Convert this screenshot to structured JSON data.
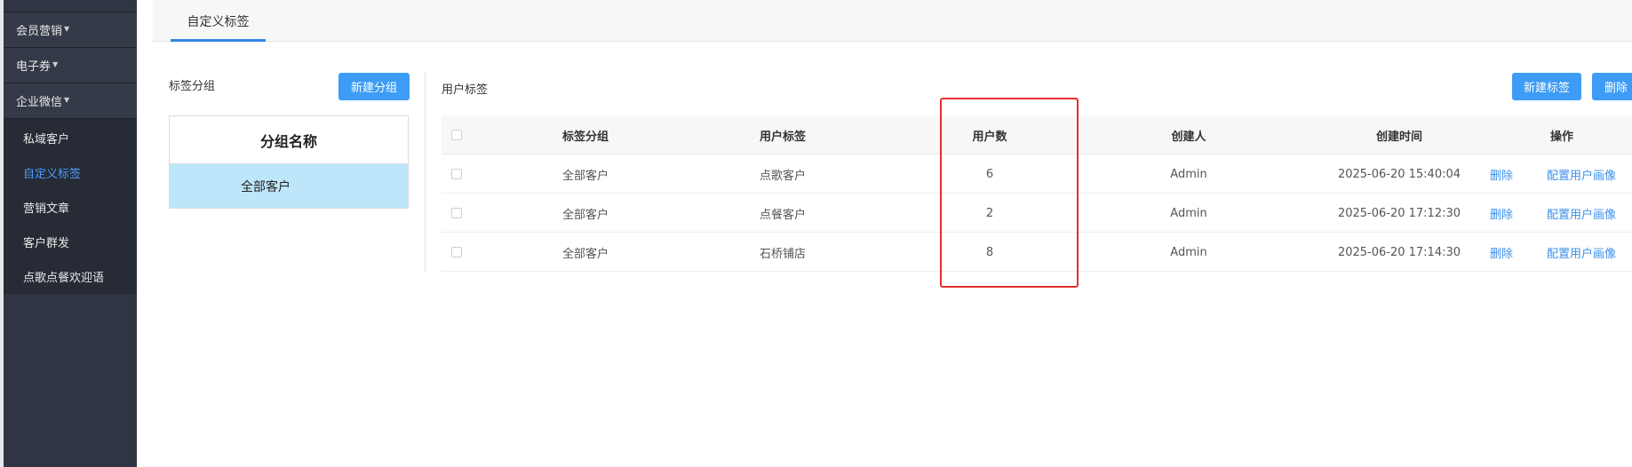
{
  "sidebar": {
    "groups": [
      {
        "label": "会员营销"
      },
      {
        "label": "电子券"
      },
      {
        "label": "企业微信"
      }
    ],
    "items": [
      {
        "label": "私域客户"
      },
      {
        "label": "自定义标签"
      },
      {
        "label": "营销文章"
      },
      {
        "label": "客户群发"
      },
      {
        "label": "点歌点餐欢迎语"
      }
    ]
  },
  "tabbar": {
    "active_tab": "自定义标签"
  },
  "groups_panel": {
    "title": "标签分组",
    "new_group_button": "新建分组",
    "table_header": "分组名称",
    "rows": [
      "全部客户"
    ]
  },
  "tags_panel": {
    "title": "用户标签",
    "new_tag_button": "新建标签",
    "delete_button": "删除",
    "columns": {
      "group": "标签分组",
      "tag": "用户标签",
      "count": "用户数",
      "creator": "创建人",
      "time": "创建时间",
      "ops": "操作"
    },
    "rows": [
      {
        "group": "全部客户",
        "tag": "点歌客户",
        "count": "6",
        "creator": "Admin",
        "time": "2025-06-20 15:40:04",
        "delete": "删除",
        "configure": "配置用户画像"
      },
      {
        "group": "全部客户",
        "tag": "点餐客户",
        "count": "2",
        "creator": "Admin",
        "time": "2025-06-20 17:12:30",
        "delete": "删除",
        "configure": "配置用户画像"
      },
      {
        "group": "全部客户",
        "tag": "石桥铺店",
        "count": "8",
        "creator": "Admin",
        "time": "2025-06-20 17:14:30",
        "delete": "删除",
        "configure": "配置用户画像"
      }
    ]
  },
  "colors": {
    "sidebar_bg": "#2f3543",
    "accent": "#3d9cf5",
    "highlight": "#e4302a"
  }
}
